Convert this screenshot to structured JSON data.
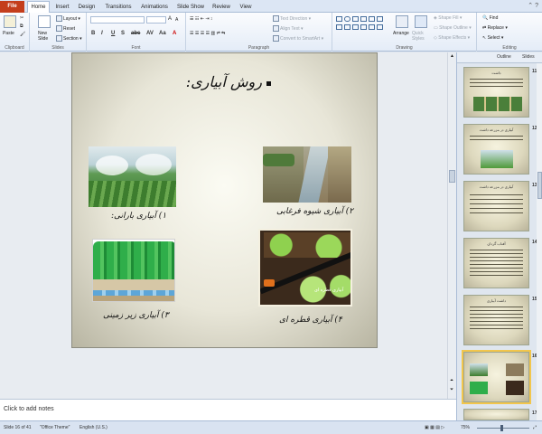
{
  "tabs": [
    "File",
    "Home",
    "Insert",
    "Design",
    "Transitions",
    "Animations",
    "Slide Show",
    "Review",
    "View"
  ],
  "ribbon": {
    "clipboard": {
      "paste": "Paste",
      "label": "Clipboard"
    },
    "slides": {
      "new_slide": "New Slide",
      "layout": "Layout",
      "reset": "Reset",
      "section": "Section",
      "label": "Slides"
    },
    "font": {
      "label": "Font"
    },
    "paragraph": {
      "text_direction": "Text Direction",
      "align_text": "Align Text",
      "convert_smartart": "Convert to SmartArt",
      "label": "Paragraph"
    },
    "drawing": {
      "arrange": "Arrange",
      "quick_styles": "Quick Styles",
      "shape_fill": "Shape Fill",
      "shape_outline": "Shape Outline",
      "shape_effects": "Shape Effects",
      "label": "Drawing"
    },
    "editing": {
      "find": "Find",
      "replace": "Replace",
      "select": "Select",
      "label": "Editing"
    }
  },
  "slide": {
    "title": "روش آبیاری:",
    "captions": [
      "۱) آبیاری بارانی:",
      "۲) آبیاری شیوه فرغابی",
      "۳) آبیاری زیر زمینی",
      "۴) آبیاری قطره ای"
    ],
    "dripbox_text": "آبیاری قطره ای"
  },
  "notes_placeholder": "Click to add notes",
  "panel": {
    "tabs": [
      "Outline",
      "Slides"
    ],
    "thumbs": [
      {
        "num": "11",
        "title": "داشت"
      },
      {
        "num": "12",
        "title": "آبیاری در مزرعه داشت"
      },
      {
        "num": "13",
        "title": "آبیاری در مزرعه داشت"
      },
      {
        "num": "14",
        "title": "آفتاب گردان"
      },
      {
        "num": "15",
        "title": "داشت آبیاری"
      },
      {
        "num": "16",
        "title": ""
      },
      {
        "num": "17",
        "title": ""
      }
    ]
  },
  "status": {
    "slide_info": "Slide 16 of 41",
    "theme": "\"Office Theme\"",
    "language": "English (U.S.)",
    "zoom": "75%"
  },
  "colors": {
    "file_tab": "#c43e1c",
    "selection": "#f2c64c",
    "ribbon": "#e4ecf7"
  }
}
